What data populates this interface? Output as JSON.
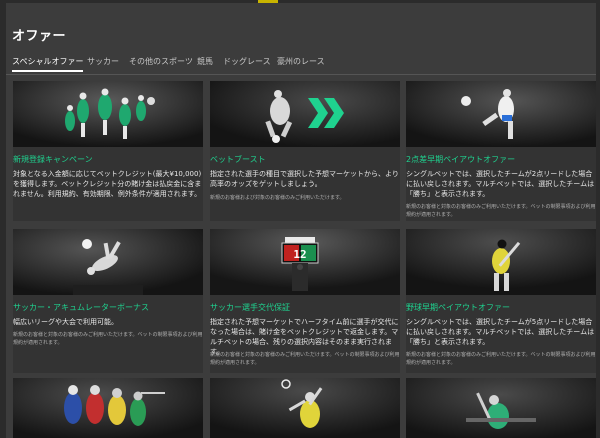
{
  "page": {
    "title": "オファー"
  },
  "tabs": [
    {
      "label": "スペシャルオファー",
      "active": true
    },
    {
      "label": "サッカー",
      "active": false
    },
    {
      "label": "その他のスポーツ",
      "active": false
    },
    {
      "label": "競馬",
      "active": false
    },
    {
      "label": "ドッグレース",
      "active": false
    },
    {
      "label": "豪州のレース",
      "active": false
    }
  ],
  "offers": [
    {
      "title": "新規登録キャンペーン",
      "desc": "対象となる入金額に応じてベットクレジット(最大¥10,000)を獲得します。ベットクレジット分の賭け金は払戻金に含まれません。利用規約、有効期限、例外条件が適用されます。",
      "terms": "",
      "icon": "soccer-players-image"
    },
    {
      "title": "ベットブースト",
      "desc": "指定された選手の種目で選択した予想マーケットから、より高率のオッズをゲットしましょう。",
      "terms": "新規のお客様および対象のお客様のみご利用いただけます。",
      "icon": "bet-boost-image"
    },
    {
      "title": "2点差早期ペイアウトオファー",
      "desc": "シングルベットでは、選択したチームが2点リードした場合に払い戻しされます。マルチベットでは、選択したチームは「勝ち」と表示されます。",
      "terms": "新規のお客様と対象のお客様のみご利用いただけます。ベットの制限事項および利用規約が適用されます。",
      "icon": "soccer-kick-image"
    },
    {
      "title": "サッカー・アキュムレーターボーナス",
      "desc": "幅広いリーグや大会で利用可能。",
      "terms": "新規のお客様と対象のお客様のみご利用いただけます。ベットの制限事項および利用規約が適用されます。",
      "icon": "bicycle-kick-image"
    },
    {
      "title": "サッカー選手交代保証",
      "desc": "指定された予想マーケットでハーフタイム前に選手が交代になった場合は、賭け金をベットクレジットで返金します。マルチベットの場合、残りの選択内容はそのまま実行されます。",
      "terms": "新規のお客様と対象のお客様のみご利用いただけます。ベットの制限事項および利用規約が適用されます。",
      "icon": "substitution-board-image"
    },
    {
      "title": "野球早期ペイアウトオファー",
      "desc": "シングルベットでは、選択したチームが5点リードした場合に払い戻しされます。マルチベットでは、選択したチームは「勝ち」と表示されます。",
      "terms": "新規のお客様と対象のお客様のみご利用いただけます。ベットの制限事項および利用規約が適用されます。",
      "icon": "baseball-batter-image"
    },
    {
      "title": "",
      "desc": "",
      "terms": "",
      "icon": "multi-sport-athletes-image"
    },
    {
      "title": "",
      "desc": "",
      "terms": "",
      "icon": "tennis-player-image"
    },
    {
      "title": "",
      "desc": "",
      "terms": "",
      "icon": "golf-player-image"
    }
  ],
  "board": {
    "text": "12"
  },
  "colors": {
    "accent": "#1fd28f",
    "background": "#3c3c3c",
    "card": "#333333"
  }
}
